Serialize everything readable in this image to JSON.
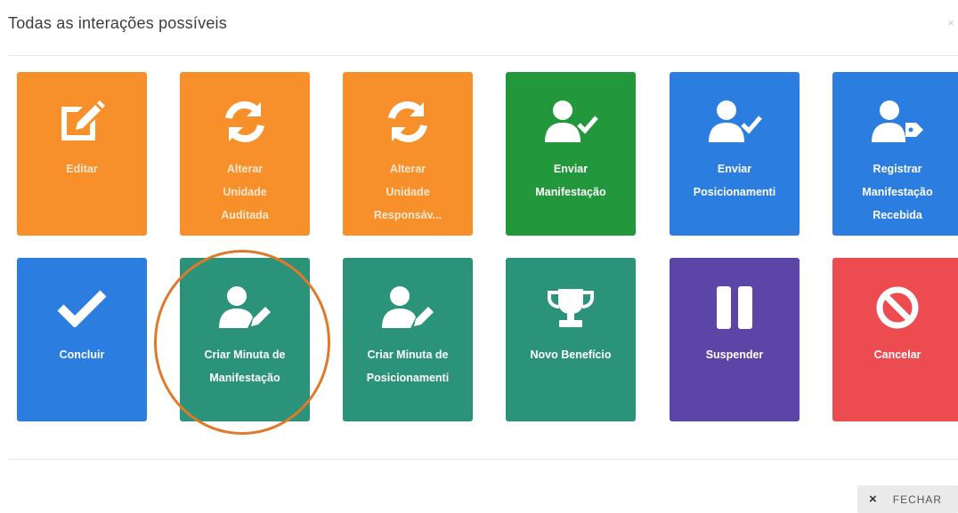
{
  "modal": {
    "title": "Todas as interações possíveis",
    "close_glyph": "×",
    "footer_button": {
      "icon": "×",
      "label": "FECHAR"
    }
  },
  "tiles": [
    {
      "label": "Editar",
      "icon": "edit-icon",
      "color": "#f7902b"
    },
    {
      "label": "Alterar\nUnidade\nAuditada",
      "icon": "refresh-icon",
      "color": "#f7902b"
    },
    {
      "label": "Alterar\nUnidade\nResponsáv...",
      "icon": "refresh-icon",
      "color": "#f7902b"
    },
    {
      "label": "Enviar\nManifestação",
      "icon": "user-check-icon",
      "color": "#22973c"
    },
    {
      "label": "Enviar\nPosicionamenti",
      "icon": "user-check-icon",
      "color": "#2b7ee0"
    },
    {
      "label": "Registrar\nManifestação\nRecebida",
      "icon": "user-tag-icon",
      "color": "#2b7ee0"
    },
    {
      "label": "Concluir",
      "icon": "check-icon",
      "color": "#2b7ee0"
    },
    {
      "label": "Criar Minuta de\nManifestação",
      "icon": "user-edit-icon",
      "color": "#2a9379"
    },
    {
      "label": "Criar Minuta de\nPosicionamenti",
      "icon": "user-edit-icon",
      "color": "#2a9379"
    },
    {
      "label": "Novo Benefício",
      "icon": "trophy-icon",
      "color": "#2a9379"
    },
    {
      "label": "Suspender",
      "icon": "pause-icon",
      "color": "#5b45a6"
    },
    {
      "label": "Cancelar",
      "icon": "ban-icon",
      "color": "#ec4b4f"
    }
  ]
}
